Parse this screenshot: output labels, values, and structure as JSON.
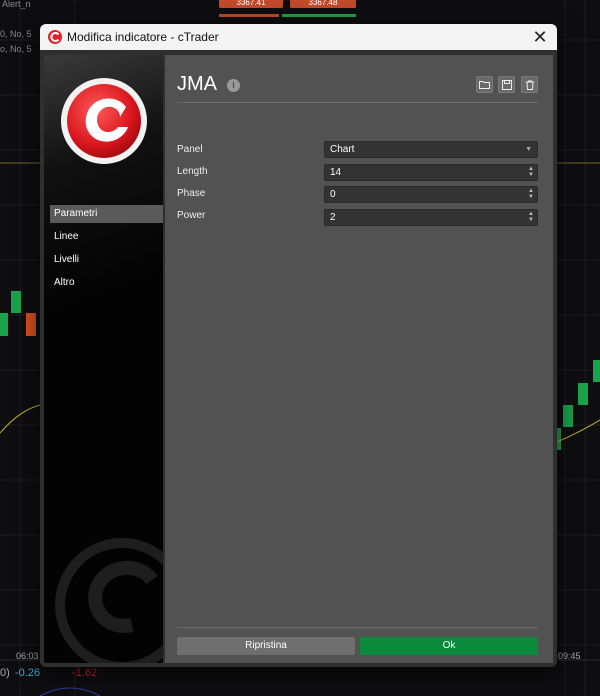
{
  "colors": {
    "accent_red": "#e0222a",
    "ok_green": "#0a8a3a",
    "candle_green": "#1aa34a",
    "candle_orange": "#d9521f",
    "curve_yellow": "#c8b03a"
  },
  "chart": {
    "top_left_label": "Alert_n",
    "left_labels": [
      "0, No, 5",
      "o, No, 5"
    ],
    "top_chip_left": "3367.41",
    "top_chip_right": "3367.48",
    "time_left": "06:03",
    "time_right": "09:45",
    "bottom_prefix": "0)",
    "bottom_val1": "-0.26",
    "bottom_val2": "-1.62"
  },
  "window": {
    "title": "Modifica indicatore - cTrader",
    "close_icon": "close-icon"
  },
  "sidebar": {
    "items": [
      {
        "label": "Parametri",
        "active": true
      },
      {
        "label": "Linee",
        "active": false
      },
      {
        "label": "Livelli",
        "active": false
      },
      {
        "label": "Altro",
        "active": false
      }
    ]
  },
  "content": {
    "heading": "JMA",
    "info_icon": "info-icon",
    "toolbar_icons": [
      "folder-icon",
      "save-icon",
      "trash-icon"
    ],
    "params": [
      {
        "label": "Panel",
        "value": "Chart",
        "type": "select"
      },
      {
        "label": "Length",
        "value": "14",
        "type": "number"
      },
      {
        "label": "Phase",
        "value": "0",
        "type": "number"
      },
      {
        "label": "Power",
        "value": "2",
        "type": "number"
      }
    ]
  },
  "footer": {
    "reset_label": "Ripristina",
    "ok_label": "Ok"
  }
}
